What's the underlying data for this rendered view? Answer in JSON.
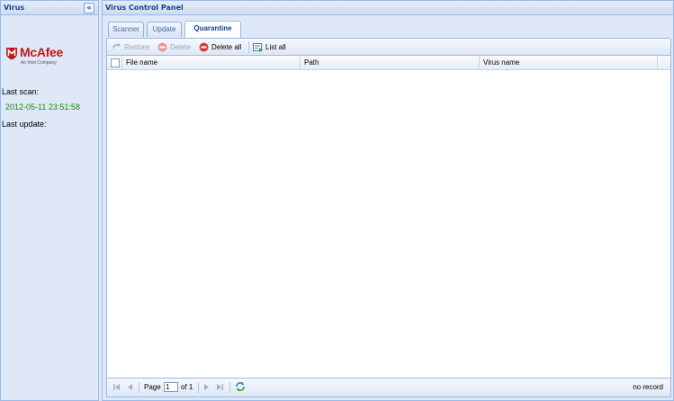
{
  "west": {
    "title": "Virus",
    "collapse_glyph": "«",
    "logo": {
      "brand": "McAfee",
      "tagline": "An Intel Company",
      "icon": "mcafee-shield-icon"
    },
    "last_scan_label": "Last scan:",
    "last_scan_value": "2012-05-11 23:51:58",
    "last_update_label": "Last update:"
  },
  "center": {
    "title": "Virus Control Panel",
    "tabs": [
      {
        "label": "Scanner"
      },
      {
        "label": "Update"
      },
      {
        "label": "Quarantine"
      }
    ],
    "toolbar": {
      "restore": "Restore",
      "delete": "Delete",
      "delete_all": "Delete all",
      "list_all": "List all"
    },
    "grid": {
      "columns": [
        "File name",
        "Path",
        "Virus name"
      ]
    },
    "paging": {
      "page_label": "Page",
      "page_value": "1",
      "of_label": "of 1",
      "status": "no record"
    }
  },
  "colors": {
    "header_text": "#15428b",
    "border": "#99bbe8",
    "panel_bg": "#dfe8f6",
    "scan_value": "#1a8a1a",
    "brand_red": "#c01818"
  }
}
